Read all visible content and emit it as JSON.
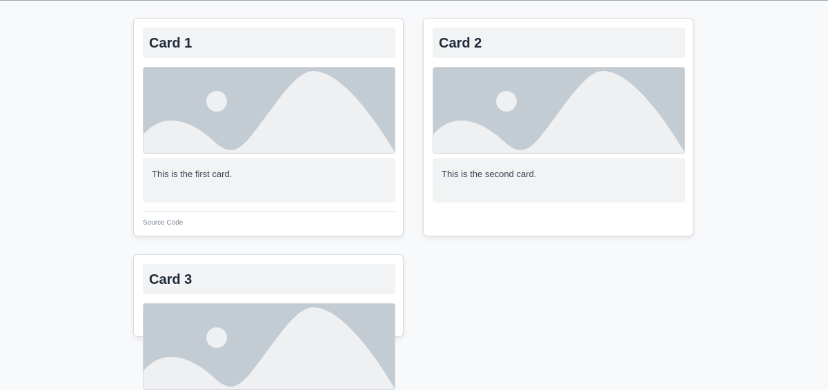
{
  "cards": [
    {
      "title": "Card 1",
      "text": "This is the first card.",
      "footer_link": "Source Code"
    },
    {
      "title": "Card 2",
      "text": "This is the second card."
    },
    {
      "title": "Card 3"
    }
  ],
  "colors": {
    "page_background": "#f8f9fb",
    "card_background": "#ffffff",
    "panel_background": "#f2f3f5",
    "placeholder_sky": "#c3cbd3",
    "placeholder_shape": "#eef0f2",
    "title_text": "#1f2937",
    "muted_text": "#7b8794"
  },
  "icons": {
    "placeholder_image": "image-placeholder-icon"
  }
}
